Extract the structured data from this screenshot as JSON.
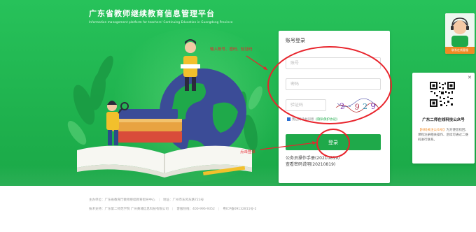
{
  "brand": {
    "title": "广东省教师继续教育信息管理平台",
    "subtitle": "Information management platform for teachers' Continuing Education in Guangdong Province"
  },
  "login": {
    "title": "账号登录",
    "username_placeholder": "账号",
    "password_placeholder": "密码",
    "captcha_placeholder": "验证码",
    "captcha_text": "2-9 2 9",
    "agree_text": "我已阅读并同意",
    "agree_link": "《隐私保护协议》",
    "button": "登录",
    "links": [
      "公务员操作手册(20210819)",
      "查看密码说明(20210819)"
    ]
  },
  "annotations": {
    "fill_hint": "输入账号、密码、验证码",
    "click_hint": "点击登录"
  },
  "customer_service": {
    "label": "联系在线客服"
  },
  "wechat": {
    "close": "✕",
    "title": "广东二师在线科技公众号",
    "desc_highlight": "【扫码关注公众号】",
    "desc": "为方便您找回、课程注册相关操作、后续可通过二维码进行联系。"
  },
  "footer": {
    "row1": [
      "主办单位：广东省教育厅教师继续教育指导中心",
      "地址：广州市东风东路723号"
    ],
    "row2": [
      "技术支持：广东第二师范学院 广州黄埔信息科技有限公司",
      "客服热线：400-996-9352",
      "粤ICP备09132811号-2"
    ]
  },
  "colors": {
    "brand_green": "#1fb24e",
    "button_green": "#1fa94a",
    "annotation_red": "#e8242c",
    "orange": "#f08a24"
  }
}
